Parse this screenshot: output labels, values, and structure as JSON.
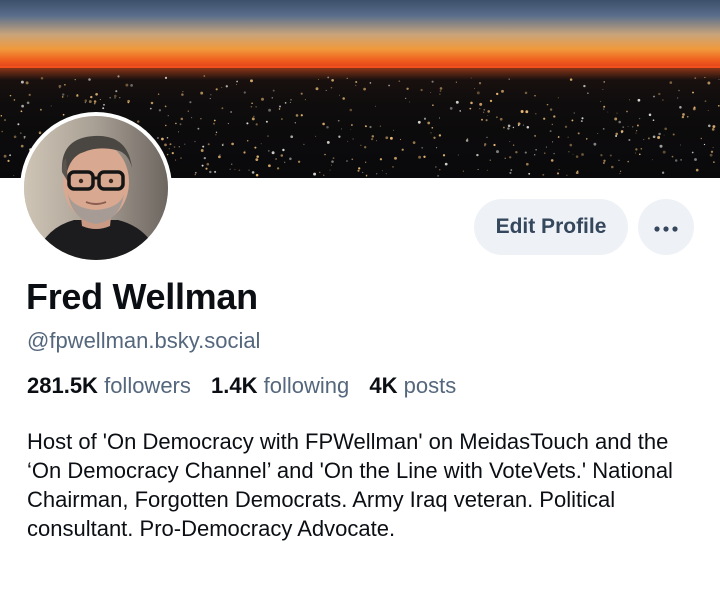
{
  "profile": {
    "name": "Fred Wellman",
    "handle": "@fpwellman.bsky.social",
    "bio": "Host of 'On Democracy with FPWellman' on MeidasTouch and the ‘On Democracy Channel’ and 'On the Line with VoteVets.' National Chairman, Forgotten Democrats. Army Iraq veteran. Political consultant. Pro-Democracy Advocate."
  },
  "stats": {
    "followers_count": "281.5K",
    "followers_label": "followers",
    "following_count": "1.4K",
    "following_label": "following",
    "posts_count": "4K",
    "posts_label": "posts"
  },
  "actions": {
    "edit_profile_label": "Edit Profile",
    "more_icon": "ellipsis-icon"
  },
  "colors": {
    "name_text": "#0b0f14",
    "secondary_text": "#55677d",
    "button_bg": "#eef2f6",
    "button_text": "#35475c"
  }
}
